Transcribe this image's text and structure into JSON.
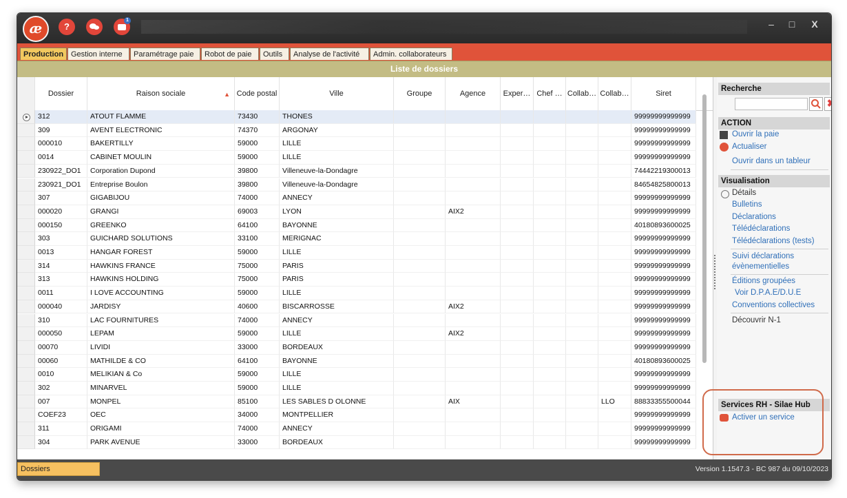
{
  "titlebar": {
    "logo": "æ",
    "icons": [
      "help-icon",
      "chat-icon",
      "messages-icon"
    ],
    "help_label": "?",
    "notif_badge": "1",
    "minimize": "–",
    "maximize": "□",
    "close": "X"
  },
  "tabs": [
    "Production",
    "Gestion interne",
    "Paramétrage paie",
    "Robot de paie",
    "Outils",
    "Analyse de l'activité",
    "Admin. collaborateurs"
  ],
  "list_title": "Liste de dossiers",
  "columns": [
    "Dossier",
    "Raison sociale",
    "Code postal",
    "Ville",
    "Groupe",
    "Agence",
    "Exper…",
    "Chef …",
    "Collab…",
    "Collab…",
    "Siret"
  ],
  "rows": [
    [
      "312",
      "ATOUT FLAMME",
      "73430",
      "THONES",
      "",
      "",
      "",
      "",
      "",
      "",
      "99999999999999"
    ],
    [
      "309",
      "AVENT ELECTRONIC",
      "74370",
      "ARGONAY",
      "",
      "",
      "",
      "",
      "",
      "",
      "99999999999999"
    ],
    [
      "000010",
      "BAKERTILLY",
      "59000",
      "LILLE",
      "",
      "",
      "",
      "",
      "",
      "",
      "99999999999999"
    ],
    [
      "0014",
      "CABINET MOULIN",
      "59000",
      "LILLE",
      "",
      "",
      "",
      "",
      "",
      "",
      "99999999999999"
    ],
    [
      "230922_DO1",
      "Corporation Dupond",
      "39800",
      "Villeneuve-la-Dondagre",
      "",
      "",
      "",
      "",
      "",
      "",
      "74442219300013"
    ],
    [
      "230921_DO1",
      "Entreprise Boulon",
      "39800",
      "Villeneuve-la-Dondagre",
      "",
      "",
      "",
      "",
      "",
      "",
      "84654825800013"
    ],
    [
      "307",
      "GIGABIJOU",
      "74000",
      "ANNECY",
      "",
      "",
      "",
      "",
      "",
      "",
      "99999999999999"
    ],
    [
      "000020",
      "GRANGI",
      "69003",
      "LYON",
      "",
      "AIX2",
      "",
      "",
      "",
      "",
      "99999999999999"
    ],
    [
      "000150",
      "GREENKO",
      "64100",
      "BAYONNE",
      "",
      "",
      "",
      "",
      "",
      "",
      "40180893600025"
    ],
    [
      "303",
      "GUICHARD SOLUTIONS",
      "33100",
      "MERIGNAC",
      "",
      "",
      "",
      "",
      "",
      "",
      "99999999999999"
    ],
    [
      "0013",
      "HANGAR FOREST",
      "59000",
      "LILLE",
      "",
      "",
      "",
      "",
      "",
      "",
      "99999999999999"
    ],
    [
      "314",
      "HAWKINS FRANCE",
      "75000",
      "PARIS",
      "",
      "",
      "",
      "",
      "",
      "",
      "99999999999999"
    ],
    [
      "313",
      "HAWKINS HOLDING",
      "75000",
      "PARIS",
      "",
      "",
      "",
      "",
      "",
      "",
      "99999999999999"
    ],
    [
      "0011",
      "I LOVE ACCOUNTING",
      "59000",
      "LILLE",
      "",
      "",
      "",
      "",
      "",
      "",
      "99999999999999"
    ],
    [
      "000040",
      "JARDISY",
      "40600",
      "BISCARROSSE",
      "",
      "AIX2",
      "",
      "",
      "",
      "",
      "99999999999999"
    ],
    [
      "310",
      "LAC FOURNITURES",
      "74000",
      "ANNECY",
      "",
      "",
      "",
      "",
      "",
      "",
      "99999999999999"
    ],
    [
      "000050",
      "LEPAM",
      "59000",
      "LILLE",
      "",
      "AIX2",
      "",
      "",
      "",
      "",
      "99999999999999"
    ],
    [
      "00070",
      "LIVIDI",
      "33000",
      "BORDEAUX",
      "",
      "",
      "",
      "",
      "",
      "",
      "99999999999999"
    ],
    [
      "00060",
      "MATHILDE & CO",
      "64100",
      "BAYONNE",
      "",
      "",
      "",
      "",
      "",
      "",
      "40180893600025"
    ],
    [
      "0010",
      "MELIKIAN & Co",
      "59000",
      "LILLE",
      "",
      "",
      "",
      "",
      "",
      "",
      "99999999999999"
    ],
    [
      "302",
      "MINARVEL",
      "59000",
      "LILLE",
      "",
      "",
      "",
      "",
      "",
      "",
      "99999999999999"
    ],
    [
      "007",
      "MONPEL",
      "85100",
      "LES SABLES D OLONNE",
      "",
      "AIX",
      "",
      "",
      "",
      "LLO",
      "88833355500044"
    ],
    [
      "COEF23",
      "OEC",
      "34000",
      "MONTPELLIER",
      "",
      "",
      "",
      "",
      "",
      "",
      "99999999999999"
    ],
    [
      "311",
      "ORIGAMI",
      "74000",
      "ANNECY",
      "",
      "",
      "",
      "",
      "",
      "",
      "99999999999999"
    ],
    [
      "304",
      "PARK AVENUE",
      "33000",
      "BORDEAUX",
      "",
      "",
      "",
      "",
      "",
      "",
      "99999999999999"
    ]
  ],
  "panel": {
    "recherche_title": "Recherche",
    "action_title": "ACTION",
    "ouvrir_paie": "Ouvrir la paie",
    "actualiser": "Actualiser",
    "ouvrir_tableur": "Ouvrir dans un tableur",
    "visualisation_title": "Visualisation",
    "details": "Détails",
    "bulletins": "Bulletins",
    "declarations": "Déclarations",
    "teledeclarations": "Télédéclarations",
    "teledeclarations_tests": "Télédéclarations (tests)",
    "suivi1": "Suivi déclarations",
    "suivi2": "évènementielles",
    "editions": "Éditions groupées",
    "dpae": "Voir D.P.A.E/D.U.E",
    "conventions": "Conventions collectives",
    "decouvrir": "Découvrir N-1",
    "services_title": "Services RH - Silae Hub",
    "activer": "Activer un service"
  },
  "status": {
    "tab": "Dossiers",
    "version": "Version 1.1547.3 - BC 987 du 09/10/2023"
  },
  "colors": {
    "accent": "#e0533a",
    "header_olive": "#c3bc84",
    "link": "#2f6fb8",
    "active_tab": "#f2c85f"
  }
}
